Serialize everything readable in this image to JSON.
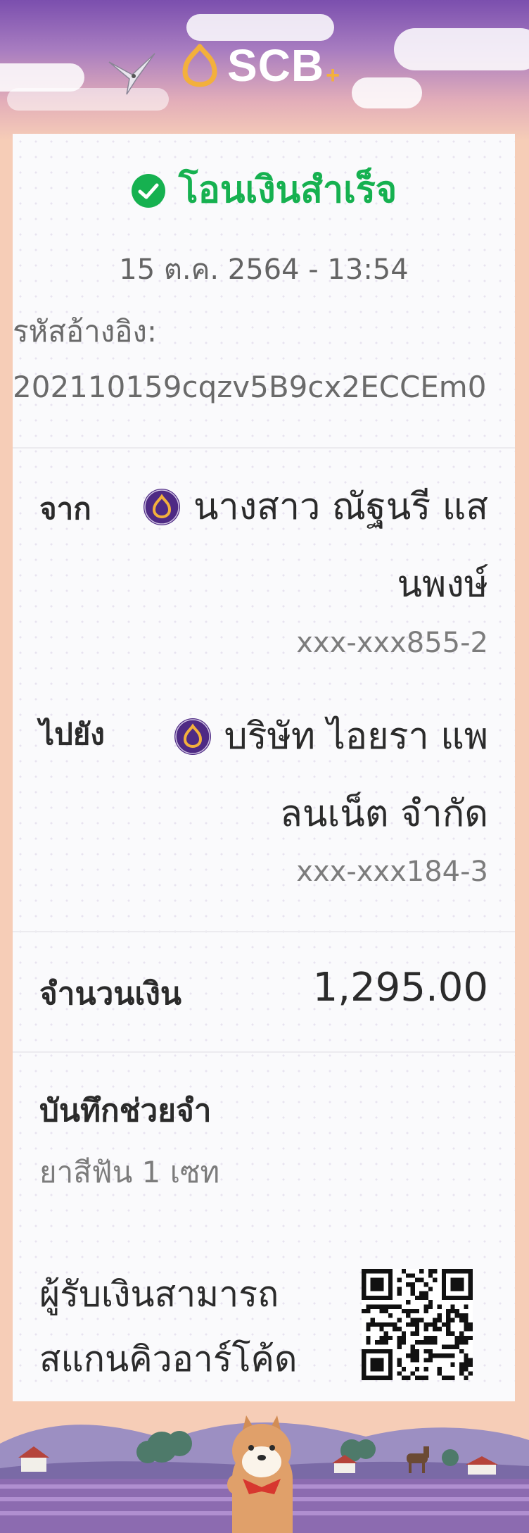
{
  "brand": {
    "name": "SCB",
    "plus": "+"
  },
  "status": {
    "title": "โอนเงินสำเร็จ",
    "icon": "check-circle-icon",
    "color": "#16b150"
  },
  "datetime": "15 ต.ค. 2564 - 13:54",
  "reference": {
    "label": "รหัสอ้างอิง:",
    "value": "202110159cqzv5B9cx2ECCEm0"
  },
  "from": {
    "label": "จาก",
    "name_line1": "นางสาว ณัฐนรี แส",
    "name_line2": "นพงษ์",
    "account": "xxx-xxx855-2",
    "bank_icon": "scb-bank-icon"
  },
  "to": {
    "label": "ไปยัง",
    "name_line1": "บริษัท ไอยรา แพ",
    "name_line2": "ลนเน็ต จำกัด",
    "account": "xxx-xxx184-3",
    "bank_icon": "scb-bank-icon"
  },
  "amount": {
    "label": "จำนวนเงิน",
    "value": "1,295.00"
  },
  "memo": {
    "label": "บันทึกช่วยจำ",
    "value": "ยาสีฟัน 1 เซท"
  },
  "qr": {
    "line1": "ผู้รับเงินสามารถ",
    "line2": "สแกนคิวอาร์โค้ด"
  },
  "colors": {
    "brand_purple": "#4e2a84",
    "brand_gold": "#f3b03c",
    "success_green": "#16b150",
    "background_peach": "#f6cdb7"
  }
}
